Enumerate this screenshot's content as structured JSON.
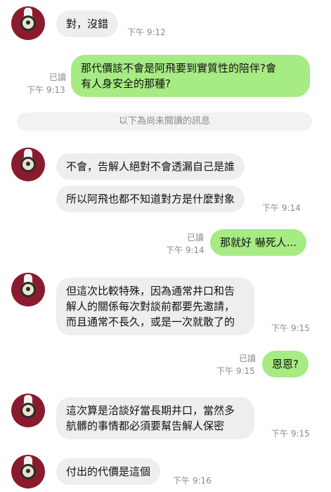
{
  "messages": [
    {
      "dir": "in",
      "text": "對，沒錯",
      "time": "下午 9:12"
    },
    {
      "dir": "out",
      "text": "那代價該不會是阿飛要到實質性的陪伴?會\n有人身安全的那種?",
      "read": "已讀",
      "time": "下午 9:13"
    },
    {
      "dir": "in",
      "text": "不會，告解人絕對不會透漏自己是誰"
    },
    {
      "dir": "in",
      "text": "所以阿飛也都不知道對方是什麼對象",
      "time": "下午 9:14"
    },
    {
      "dir": "out",
      "text": "那就好 嚇死人...",
      "read": "已讀",
      "time": "下午 9:14"
    },
    {
      "dir": "in",
      "text": "但這次比較特殊，因為通常井口和告\n解人的關係每次對談前都要先邀請，\n而且通常不長久，或是一次就散了的",
      "time": "下午 9:15"
    },
    {
      "dir": "out",
      "text": "恩恩?",
      "read": "已讀",
      "time": "下午 9:15"
    },
    {
      "dir": "in",
      "text": "這次算是洽談好當長期井口，當然多\n航髒的事情都必須要幫告解人保密",
      "time": "下午 9:15"
    },
    {
      "dir": "in",
      "text": "付出的代價是這個",
      "time": "下午 9:16"
    }
  ],
  "divider": "以下為尚未閱讀的訊息"
}
